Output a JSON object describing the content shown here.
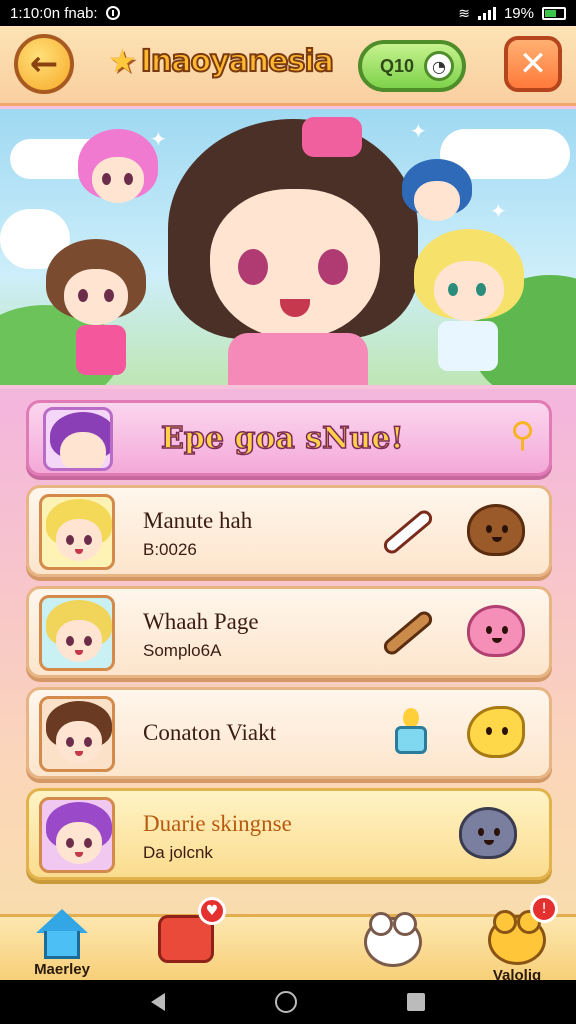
{
  "status_bar": {
    "time_text": "1:10:0n fnab:",
    "battery_text": "19%"
  },
  "header": {
    "title": "Inaoyanesia",
    "pill_label": "Q10",
    "back_icon": "back-arrow-icon",
    "close_icon": "close-icon"
  },
  "banner": {
    "text": "Epe goa sNue!"
  },
  "rows": [
    {
      "title": "Manute hah",
      "subtitle": "B:0026",
      "style": "plain"
    },
    {
      "title": "Whaah Page",
      "subtitle": "Somplo6A",
      "style": "plain"
    },
    {
      "title": "Conaton Viakt",
      "subtitle": "",
      "style": "plain"
    },
    {
      "title": "Duarie skingnse",
      "subtitle": "Da jolcnk",
      "style": "yellow"
    }
  ],
  "bottom_nav": {
    "home_label": "Maerley",
    "profile_label": "Valolig"
  },
  "colors": {
    "accent_pink": "#f4a9d8",
    "accent_orange": "#ff7a3b",
    "accent_green": "#7ed24b"
  }
}
